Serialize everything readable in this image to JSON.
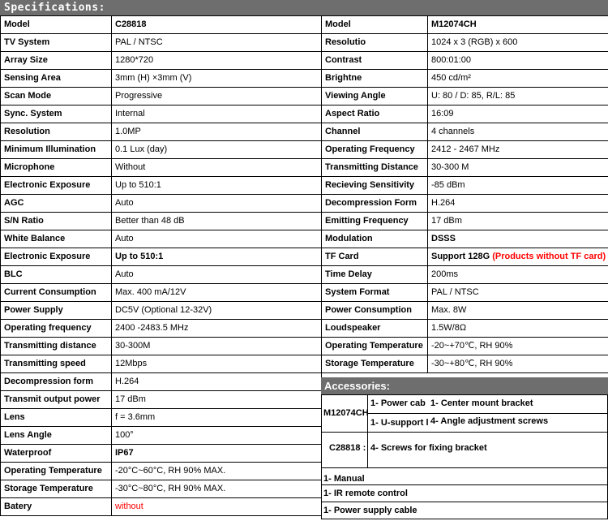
{
  "section_title": "Specifications:",
  "left_rows": [
    {
      "label": "Model",
      "value": "C28818"
    },
    {
      "label": "TV System",
      "value": "PAL / NTSC"
    },
    {
      "label": "Array  Size",
      "value": "1280*720"
    },
    {
      "label": "Sensing Area",
      "value": "3mm (H) ×3mm (V)"
    },
    {
      "label": "Scan Mode",
      "value": "Progressive"
    },
    {
      "label": "Sync. System",
      "value": "Internal"
    },
    {
      "label": "Resolution",
      "value": "1.0MP"
    },
    {
      "label": "Minimum Illumination",
      "value": "0.1 Lux (day)"
    },
    {
      "label": "Microphone",
      "value": "Without"
    },
    {
      "label": "Electronic Exposure",
      "value": "Up to 510:1"
    },
    {
      "label": "AGC",
      "value": "Auto"
    },
    {
      "label": "S/N Ratio",
      "value": "Better than 48 dB"
    },
    {
      "label": "White Balance",
      "value": "Auto"
    },
    {
      "label": "Electronic Exposure",
      "value": "Up to 510:1"
    },
    {
      "label": "BLC",
      "value": "Auto"
    },
    {
      "label": "Current Consumption",
      "value": "Max. 400 mA/12V"
    },
    {
      "label": "Power Supply",
      "value": "DC5V (Optional 12-32V)"
    },
    {
      "label": "Operating frequency",
      "value": "2400 -2483.5 MHz"
    },
    {
      "label": "Transmitting distance",
      "value": "30-300M"
    },
    {
      "label": "Transmitting speed",
      "value": "12Mbps"
    },
    {
      "label": "Decompression form",
      "value": "H.264"
    },
    {
      "label": "Transmit output power",
      "value": "17 dBm"
    },
    {
      "label": "Lens",
      "value": "f = 3.6mm"
    },
    {
      "label": "Lens Angle",
      "value": "100°"
    },
    {
      "label": "Waterproof",
      "value": "IP67"
    },
    {
      "label": "Operating Temperature",
      "value": "-20°C~60°C, RH 90% MAX."
    },
    {
      "label": "Storage Temperature",
      "value": "-30°C~80°C, RH 90% MAX."
    },
    {
      "label": "Batery",
      "value": "without"
    }
  ],
  "right_rows": [
    {
      "label": "Model",
      "value": "M12074CH"
    },
    {
      "label": "Resolutio",
      "value": "1024 x 3 (RGB) x 600"
    },
    {
      "label": "Contrast",
      "value": "800:01:00"
    },
    {
      "label": "Brightne",
      "value": "450 cd/m²"
    },
    {
      "label": "Viewing Angle",
      "value": "U: 80 / D: 85, R/L: 85"
    },
    {
      "label": "Aspect Ratio",
      "value": "16:09"
    },
    {
      "label": "Channel",
      "value": "4 channels"
    },
    {
      "label": "Operating Frequency",
      "value": "2412 - 2467 MHz"
    },
    {
      "label": "Transmitting Distance",
      "value": "30-300 M"
    },
    {
      "label": "Recieving Sensitivity",
      "value": "-85 dBm"
    },
    {
      "label": "Decompression Form",
      "value": "H.264"
    },
    {
      "label": "Emitting Frequency",
      "value": "17 dBm"
    },
    {
      "label": "Modulation",
      "value": "DSSS"
    },
    {
      "label": "TF Card",
      "value": "Support 128G ",
      "note": "(Products without TF card)"
    },
    {
      "label": "Time Delay",
      "value": "200ms"
    },
    {
      "label": "System Format",
      "value": "PAL / NTSC"
    },
    {
      "label": "Power Consumption",
      "value": "Max. 8W"
    },
    {
      "label": "Loudspeaker",
      "value": "1.5W/8Ω"
    },
    {
      "label": "Operating Temperature",
      "value": "-20~+70℃, RH 90%"
    },
    {
      "label": "Storage Temperature",
      "value": "-30~+80℃, RH 90%"
    }
  ],
  "accessories": {
    "title": "Accessories:",
    "m_model": "M12074CH",
    "m_item1a": "1- Power  cab",
    "m_item1b": "1- Center mount bracket",
    "m_item2a": "1- U-support l",
    "m_item2b": "4- Angle adjustment screws",
    "c_model": "C28818 :",
    "c_item": "4- Screws for fixing bracket",
    "extra": [
      "1- Manual",
      "1- IR remote control",
      "1- Power supply cable"
    ]
  }
}
